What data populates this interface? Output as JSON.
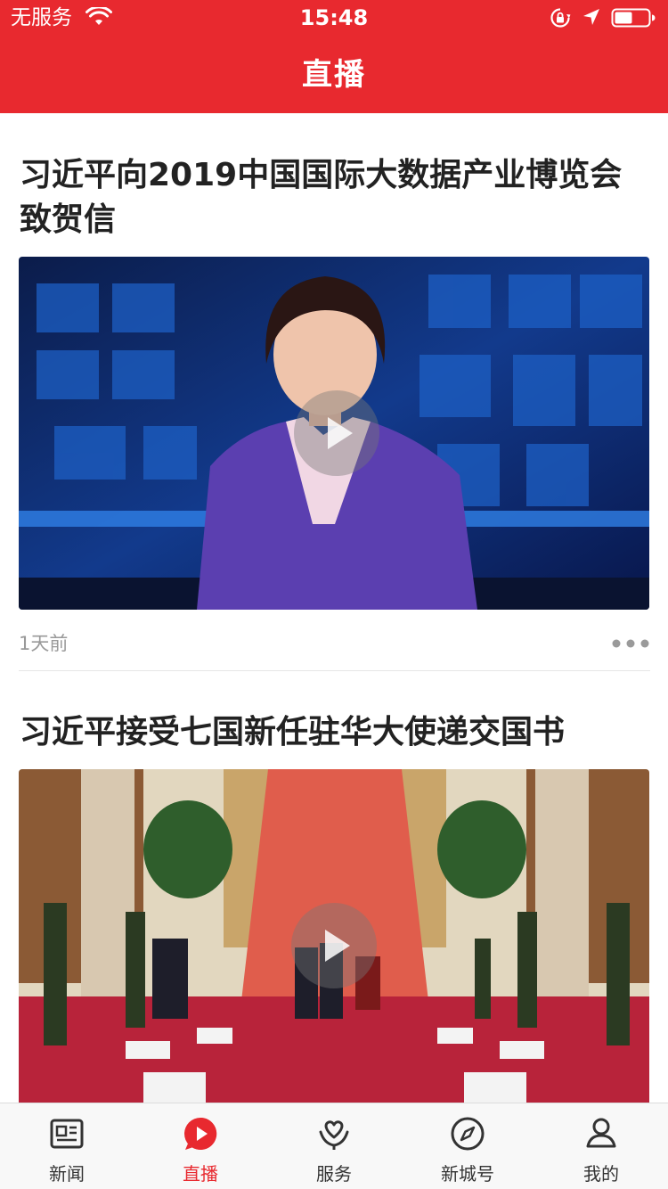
{
  "status_bar": {
    "carrier": "无服务",
    "time": "15:48"
  },
  "nav": {
    "title": "直播"
  },
  "articles": [
    {
      "title": "习近平向2019中国国际大数据产业博览会致贺信",
      "time_ago": "1天前"
    },
    {
      "title": "习近平接受七国新任驻华大使递交国书"
    }
  ],
  "tabs": [
    {
      "label": "新闻",
      "icon": "newspaper-icon"
    },
    {
      "label": "直播",
      "icon": "play-icon",
      "active": true
    },
    {
      "label": "服务",
      "icon": "service-icon"
    },
    {
      "label": "新城号",
      "icon": "compass-icon"
    },
    {
      "label": "我的",
      "icon": "user-icon"
    }
  ],
  "colors": {
    "brand": "#e8292f",
    "text": "#222222",
    "muted": "#999999",
    "tab_bar": "#f8f8f8"
  }
}
